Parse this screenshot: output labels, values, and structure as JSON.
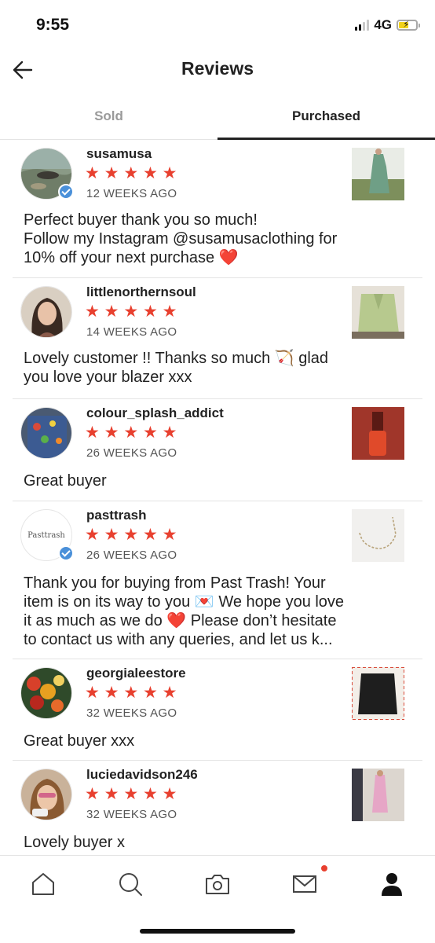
{
  "status_bar": {
    "time": "9:55",
    "network": "4G"
  },
  "header": {
    "title": "Reviews"
  },
  "tabs": [
    {
      "label": "Sold",
      "active": false
    },
    {
      "label": "Purchased",
      "active": true
    }
  ],
  "reviews": [
    {
      "username": "susamusa",
      "stars": "★ ★ ★ ★ ★",
      "rating": 5,
      "time": "12 WEEKS AGO",
      "verified": true,
      "text": "Perfect buyer thank you so much!\nFollow my Instagram @susamusaclothing for\n10% off your next purchase ❤️"
    },
    {
      "username": "littlenorthernsoul",
      "stars": "★ ★ ★ ★ ★",
      "rating": 5,
      "time": "14 WEEKS AGO",
      "verified": false,
      "text": "Lovely customer !! Thanks so much 🏹 glad\nyou love your blazer xxx"
    },
    {
      "username": "colour_splash_addict",
      "stars": "★ ★ ★ ★ ★",
      "rating": 5,
      "time": "26 WEEKS AGO",
      "verified": false,
      "text": "Great buyer"
    },
    {
      "username": "pasttrash",
      "stars": "★ ★ ★ ★ ★",
      "rating": 5,
      "time": "26 WEEKS AGO",
      "verified": true,
      "avatar_text": "Pasttrash",
      "text": "Thank you for buying from Past Trash! Your\nitem is on its way to you 💌 We hope you love\nit as much as we do ❤️ Please don’t hesitate\nto contact us with any queries, and let us k..."
    },
    {
      "username": "georgialeestore",
      "stars": "★ ★ ★ ★ ★",
      "rating": 5,
      "time": "32 WEEKS AGO",
      "verified": false,
      "text": "Great buyer xxx"
    },
    {
      "username": "luciedavidson246",
      "stars": "★ ★ ★ ★ ★",
      "rating": 5,
      "time": "32 WEEKS AGO",
      "verified": false,
      "text": "Lovely buyer x"
    }
  ],
  "bottom_nav": [
    {
      "icon": "home-icon"
    },
    {
      "icon": "search-icon"
    },
    {
      "icon": "camera-icon"
    },
    {
      "icon": "mail-icon",
      "notification": true
    },
    {
      "icon": "profile-icon"
    }
  ],
  "colors": {
    "star": "#e8402f",
    "verified": "#4a90d9",
    "tab_active": "#222222",
    "tab_inactive": "#9a9a9a"
  }
}
